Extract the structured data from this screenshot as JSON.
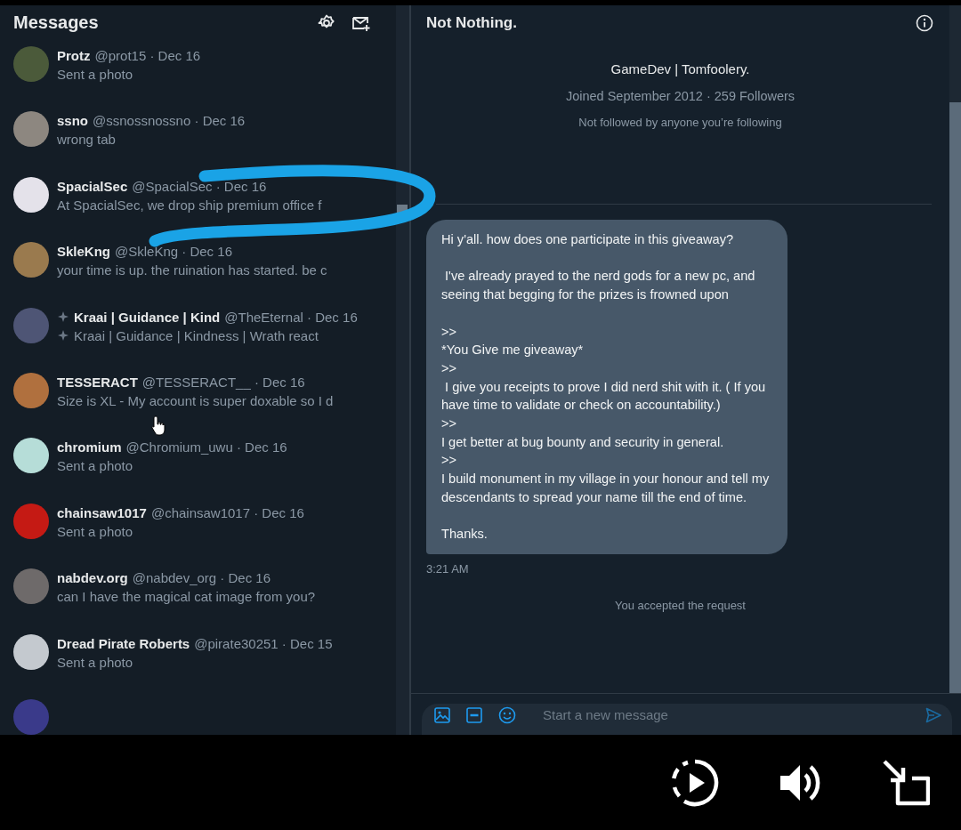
{
  "sidebar": {
    "title": "Messages",
    "conversations": [
      {
        "name": "Protz",
        "meta": "@prot15 · Dec 16",
        "preview": "Sent a photo",
        "color": "#4b5a3a",
        "prefix_icon": false
      },
      {
        "name": "ssno",
        "meta": "@ssnossnossno · Dec 16",
        "preview": "wrong tab",
        "color": "#8d8780",
        "prefix_icon": false
      },
      {
        "name": "SpacialSec",
        "meta": "@SpacialSec · Dec 16",
        "preview": "At SpacialSec, we drop ship premium office f",
        "color": "#e4e2ea",
        "prefix_icon": false
      },
      {
        "name": "SkleKng",
        "meta": "@SkleKng · Dec 16",
        "preview": "your time is up. the ruination has started. be c",
        "color": "#9a7a4e",
        "prefix_icon": false
      },
      {
        "name": "Kraai | Guidance | Kind",
        "meta": "@TheEternal · Dec 16",
        "preview": "Kraai | Guidance | Kindness | Wrath react",
        "color": "#4e5575",
        "prefix_icon": true
      },
      {
        "name": "TESSERACT",
        "meta": "@TESSERACT__ · Dec 16",
        "preview": "Size is XL - My account is super doxable so I d",
        "color": "#b0703e",
        "prefix_icon": false
      },
      {
        "name": "chromium",
        "meta": "@Chromium_uwu · Dec 16",
        "preview": "Sent a photo",
        "color": "#b6ddd8",
        "prefix_icon": false
      },
      {
        "name": "chainsaw1017",
        "meta": "@chainsaw1017 · Dec 16",
        "preview": "Sent a photo",
        "color": "#c51a14",
        "prefix_icon": false
      },
      {
        "name": "nabdev.org",
        "meta": "@nabdev_org · Dec 16",
        "preview": "can I have the magical cat image from you?",
        "color": "#6e6a6a",
        "prefix_icon": false
      },
      {
        "name": "Dread Pirate Roberts",
        "meta": "@pirate30251 · Dec 15",
        "preview": "Sent a photo",
        "color": "#c4c9cf",
        "prefix_icon": false
      }
    ]
  },
  "chat": {
    "title": "Not Nothing.",
    "bio": "GameDev | Tomfoolery.",
    "joined": "Joined September 2012 · 259 Followers",
    "mutuals": "Not followed by anyone you’re following",
    "message": {
      "text": "Hi y'all. how does one participate in this giveaway?\n\n I've already prayed to the nerd gods for a new pc, and seeing that begging for the prizes is frowned upon\n\n>>\n*You Give me giveaway*\n>>\n I give you receipts to prove I did nerd shit with it. ( If you have time to validate or check on accountability.)\n>>\nI get better at bug bounty and security in general.\n>>\nI build monument in my village in your honour and tell my descendants to spread your name till the end of time.\n\nThanks.",
      "time": "3:21 AM"
    },
    "notice": "You accepted the request",
    "composer": {
      "placeholder": "Start a new message"
    }
  }
}
